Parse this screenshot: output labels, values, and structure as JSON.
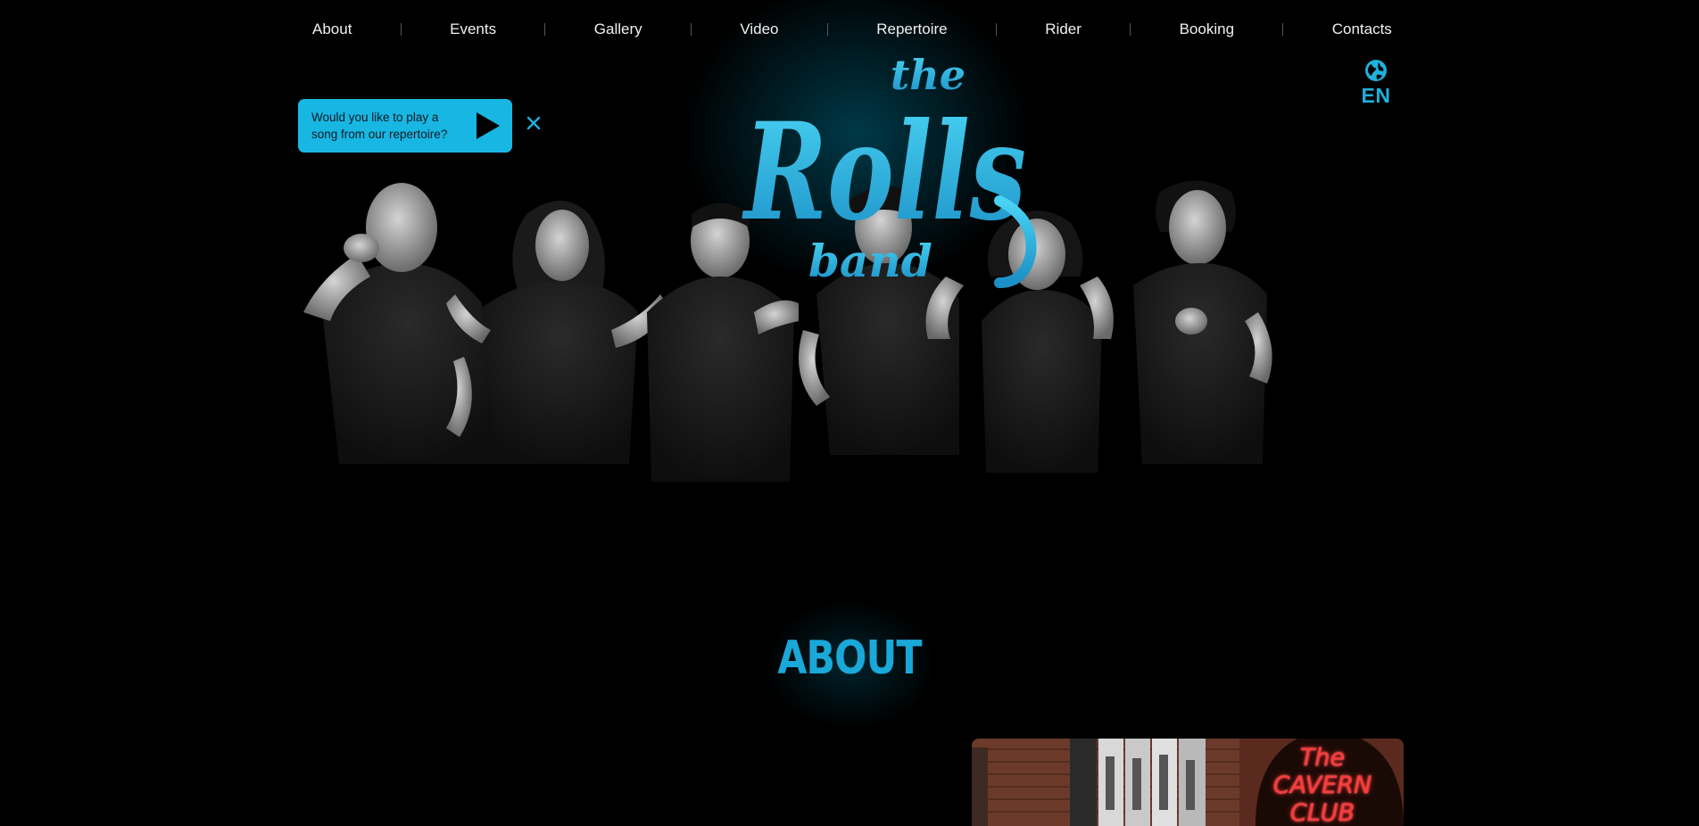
{
  "nav": {
    "items": [
      "About",
      "Events",
      "Gallery",
      "Video",
      "Repertoire",
      "Rider",
      "Booking",
      "Contacts"
    ]
  },
  "language": {
    "label": "EN",
    "icon": "globe-icon"
  },
  "song_prompt": {
    "line1": "Would you like to play a",
    "line2": "song from our repertoire?",
    "play_icon": "play-icon",
    "close_icon": "close-icon"
  },
  "logo": {
    "top": "the",
    "middle": "Rolls",
    "bottom": "band"
  },
  "about": {
    "title": "ABOUT"
  },
  "cavern_photo": {
    "sign_line1": "The",
    "sign_line2": "CAVERN",
    "sign_line3": "CLUB"
  },
  "colors": {
    "accent": "#18b6e2",
    "background": "#000000",
    "cavern_red": "#ff3a3a"
  }
}
